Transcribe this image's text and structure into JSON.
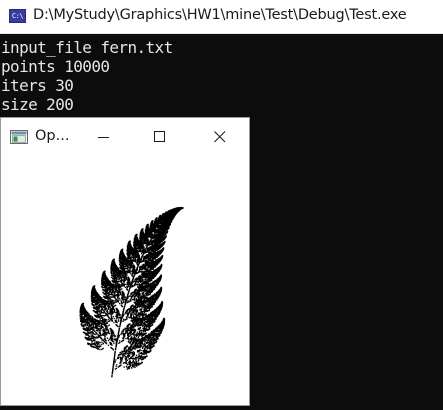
{
  "console": {
    "icon_label": "C:\\",
    "title": "D:\\MyStudy\\Graphics\\HW1\\mine\\Test\\Debug\\Test.exe",
    "lines": [
      "input_file fern.txt",
      "points 10000",
      "iters 30",
      "size 200"
    ]
  },
  "gl_window": {
    "title": "Op...",
    "controls": {
      "minimize": "minimize",
      "maximize": "maximize",
      "close": "close"
    },
    "canvas": {
      "content": "barnsley-fern",
      "fern_color": "#000000",
      "background": "#ffffff"
    }
  },
  "colors": {
    "console_background": "#0c0c0c",
    "console_text": "#e6e6e6",
    "titlebar": "#ffffff",
    "cmd_icon": "#3c3a9c"
  }
}
